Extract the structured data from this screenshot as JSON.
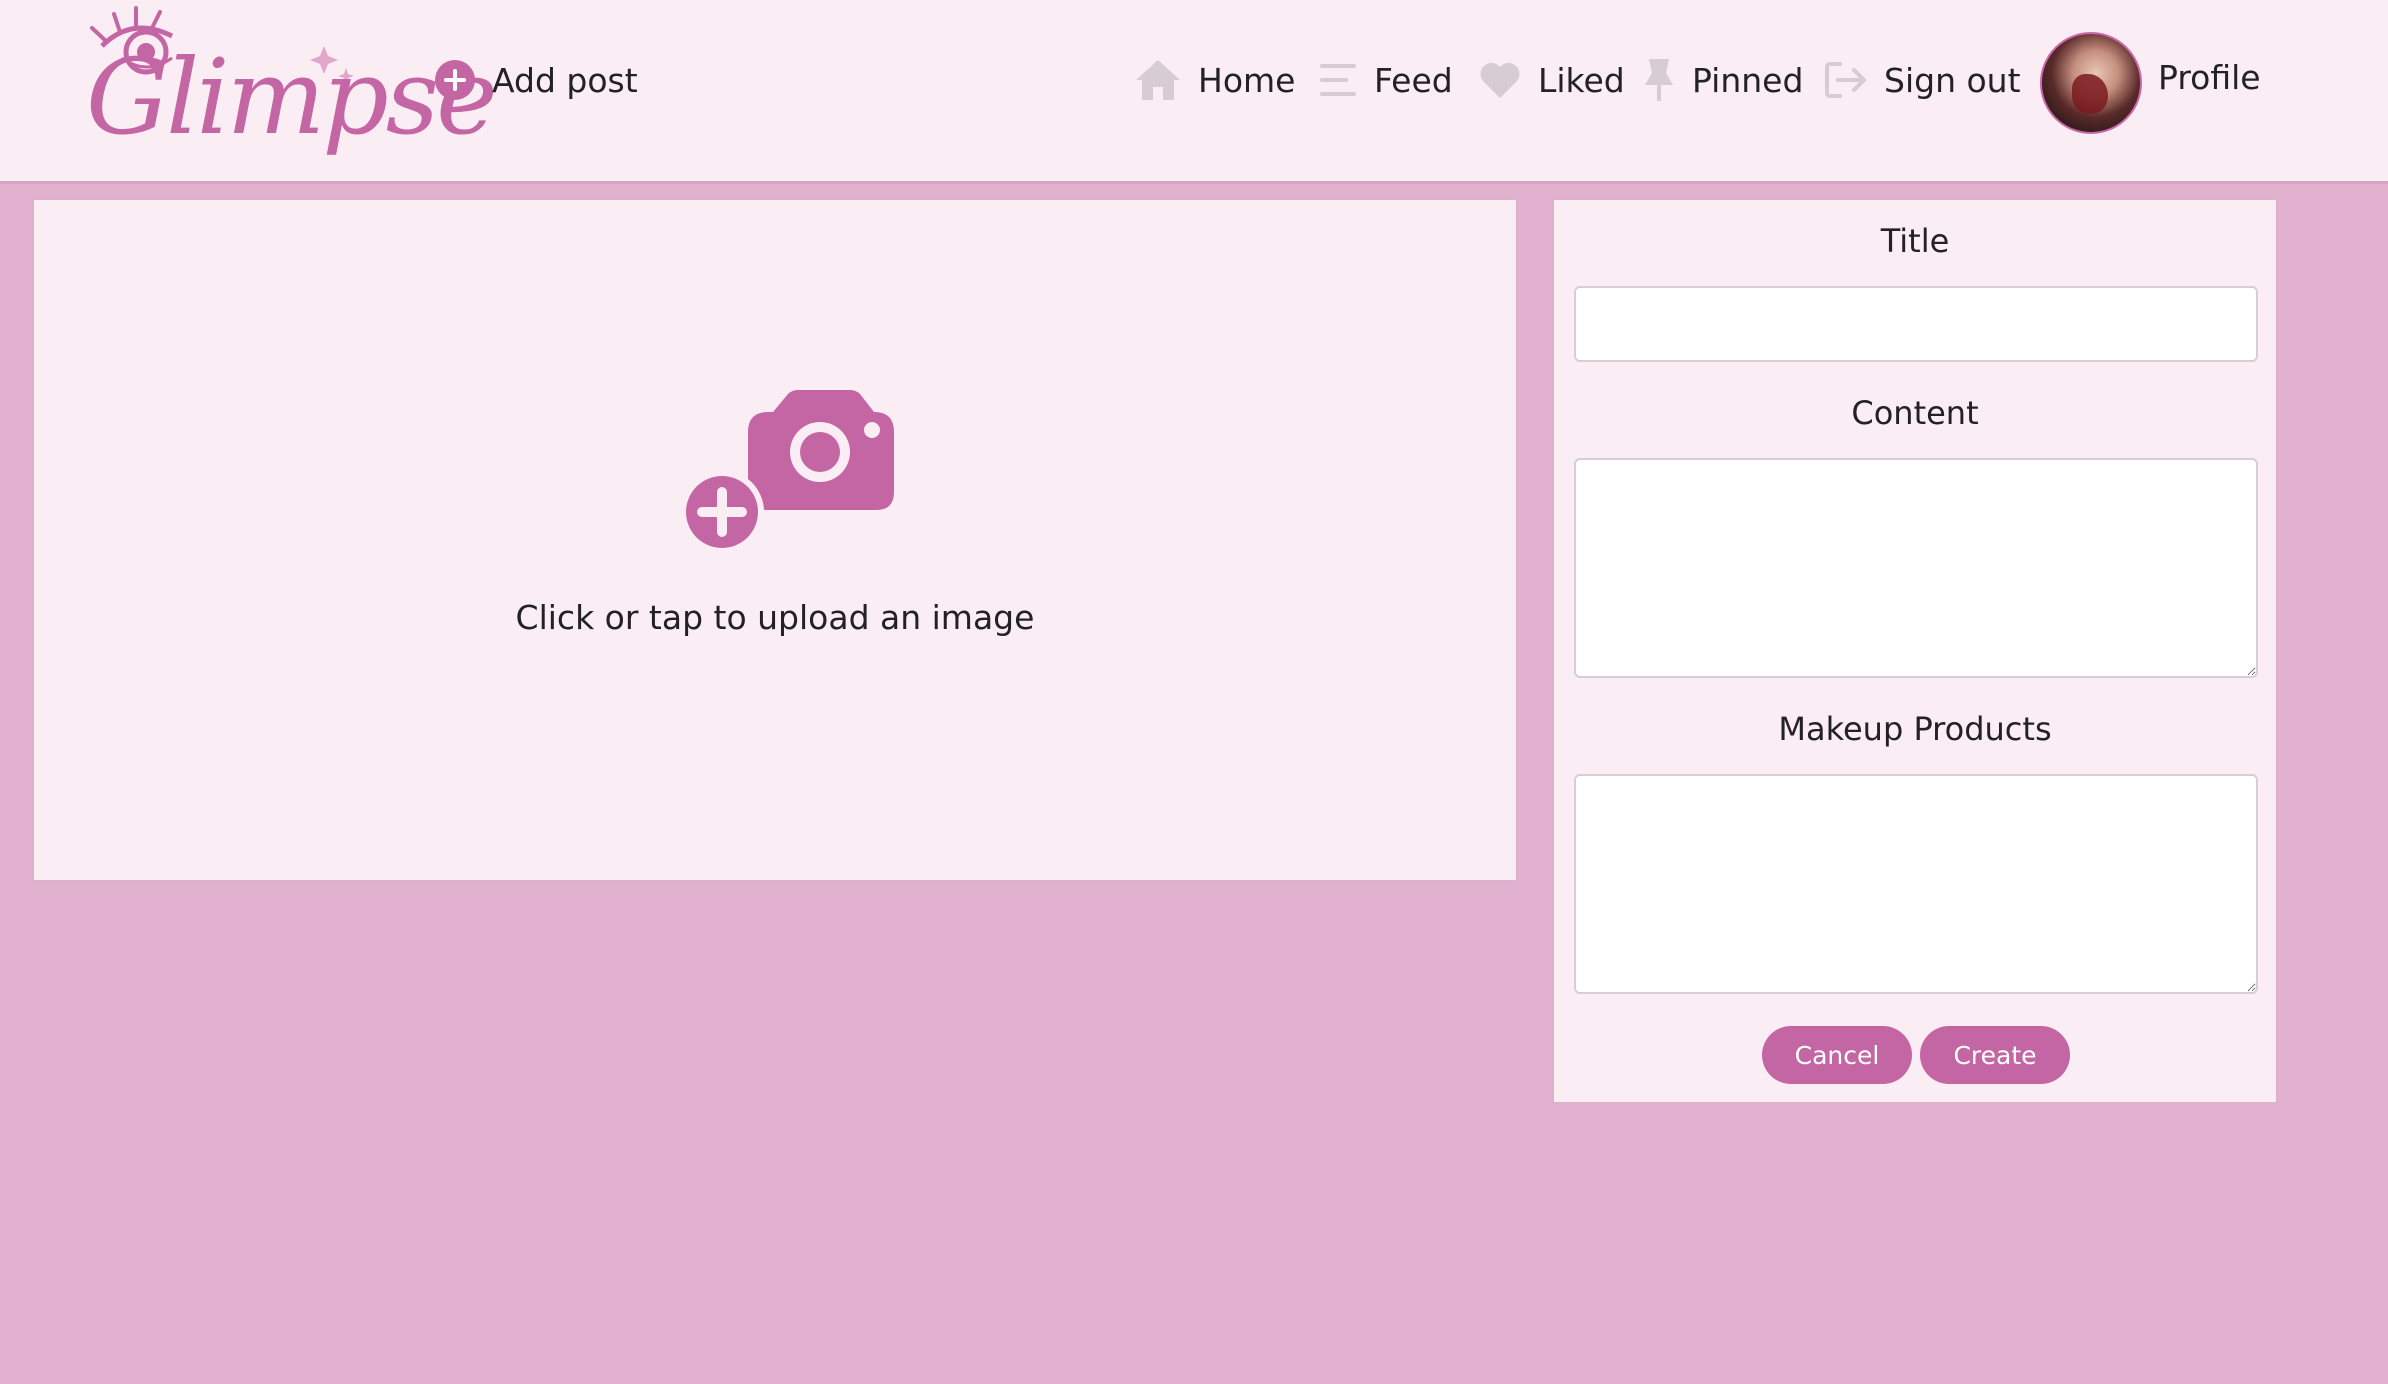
{
  "app": {
    "logo_text": "Glimpse"
  },
  "header": {
    "add_post_label": "Add post",
    "nav": {
      "home": "Home",
      "feed": "Feed",
      "liked": "Liked",
      "pinned": "Pinned",
      "sign_out": "Sign out",
      "profile": "Profile"
    }
  },
  "upload": {
    "prompt": "Click or tap to upload an image",
    "icon": "camera-plus-icon"
  },
  "form": {
    "title_label": "Title",
    "title_value": "",
    "content_label": "Content",
    "content_value": "",
    "products_label": "Makeup Products",
    "products_value": "",
    "cancel_label": "Cancel",
    "create_label": "Create"
  },
  "colors": {
    "accent": "#c466a3",
    "background": "#e2b1cf",
    "panel": "#fbedf4",
    "nav_icon": "#d6ccd2"
  }
}
